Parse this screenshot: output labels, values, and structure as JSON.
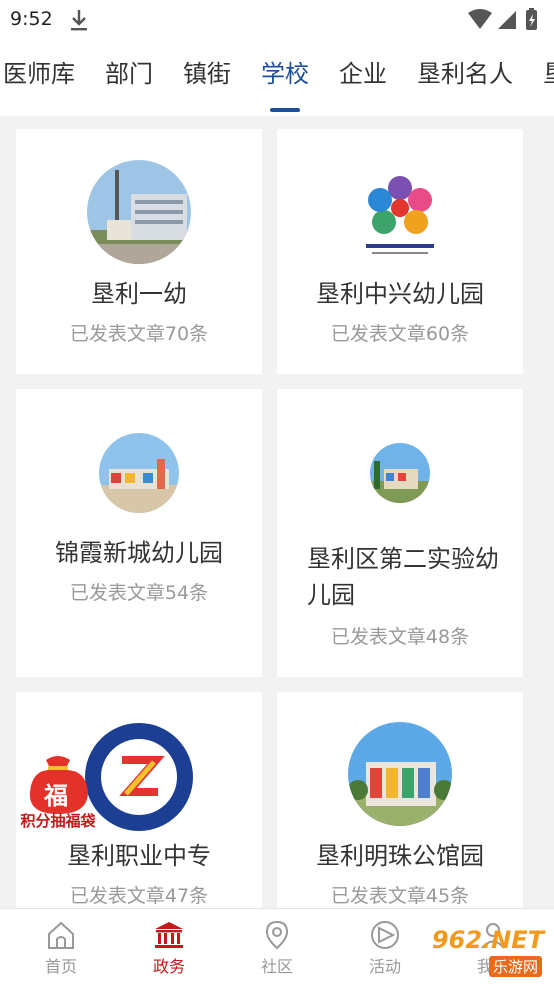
{
  "status_bar": {
    "time": "9:52"
  },
  "tabs": [
    "医师库",
    "部门",
    "镇街",
    "学校",
    "企业",
    "垦利名人",
    "垦"
  ],
  "active_tab": 3,
  "cards": [
    {
      "title": "垦利一幼",
      "meta": "已发表文章70条"
    },
    {
      "title": "垦利中兴幼儿园",
      "meta": "已发表文章60条"
    },
    {
      "title": "锦霞新城幼儿园",
      "meta": "已发表文章54条"
    },
    {
      "title_line1": "垦利区第二实验幼",
      "title_line2": "儿园",
      "meta": "已发表文章48条"
    },
    {
      "title": "垦利职业中专",
      "meta": "已发表文章47条"
    },
    {
      "title": "垦利明珠公馆园",
      "meta": "已发表文章45条"
    }
  ],
  "promo": {
    "label": "积分抽福袋",
    "char": "福"
  },
  "bottom_nav": [
    {
      "label": "首页",
      "icon": "home-icon"
    },
    {
      "label": "政务",
      "icon": "government-building-icon"
    },
    {
      "label": "社区",
      "icon": "location-pin-icon"
    },
    {
      "label": "活动",
      "icon": "activity-icon"
    },
    {
      "label": "我的",
      "icon": "person-icon"
    }
  ],
  "watermark": {
    "brand": "962.NET",
    "sub": "乐游网"
  },
  "colors": {
    "accent_blue": "#1b4f9c",
    "nav_active_red": "#c21a1a",
    "page_bg": "#f2f2f2"
  }
}
